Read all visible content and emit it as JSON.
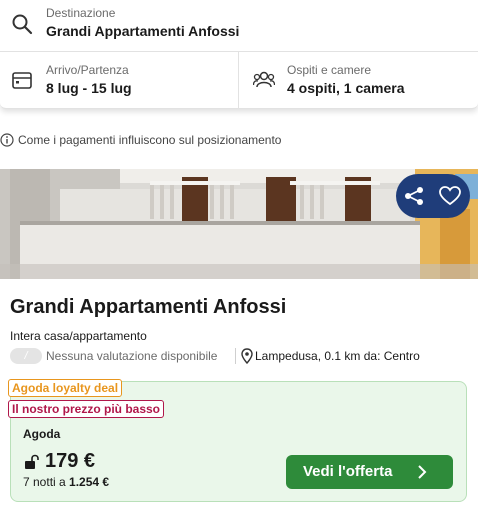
{
  "search": {
    "destination_label": "Destinazione",
    "destination_value": "Grandi Appartamenti Anfossi",
    "dates_label": "Arrivo/Partenza",
    "dates_value": "8 lug - 15 lug",
    "guests_label": "Ospiti e camere",
    "guests_value": "4 ospiti, 1 camera"
  },
  "info": {
    "text": "Come i pagamenti influiscono sul posizionamento"
  },
  "listing": {
    "title": "Grandi Appartamenti Anfossi",
    "type": "Intera casa/appartamento",
    "rating_pill": "/",
    "rating_text": "Nessuna valutazione disponibile",
    "location": "Lampedusa, 0.1 km da: Centro"
  },
  "offer": {
    "badge_loyalty": "Agoda loyalty deal",
    "badge_price": "Il nostro prezzo più basso",
    "provider": "Agoda",
    "price": "179 €",
    "nights_prefix": "7 notti a",
    "total": "1.254 €",
    "cta_label": "Vedi l'offerta"
  },
  "icons": {
    "search": "search-icon",
    "calendar": "calendar-icon",
    "guests": "guests-icon",
    "info": "info-icon",
    "share": "share-icon",
    "heart": "heart-icon",
    "location": "location-pin-icon",
    "lock": "unlock-icon",
    "chevron": "chevron-right-icon"
  },
  "colors": {
    "accent_green": "#2e8b3a",
    "offer_bg": "#eaf7ea",
    "loyalty_orange": "#e8961e",
    "price_badge_red": "#b0174a",
    "action_pill_blue": "#1f3d7a"
  }
}
